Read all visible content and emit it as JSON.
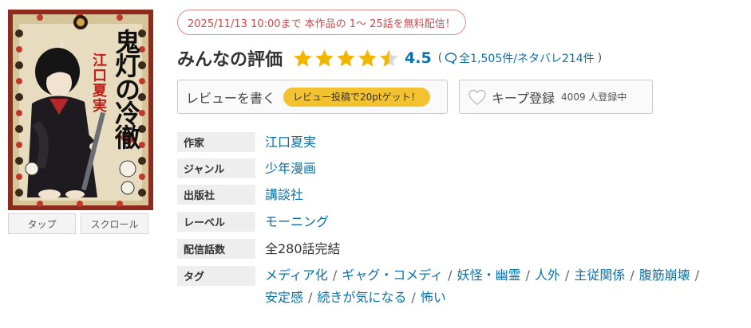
{
  "cover": {
    "title": "鬼灯の冷徹",
    "author": "江口夏実",
    "buttons": [
      "タップ",
      "スクロール"
    ]
  },
  "campaign": {
    "text": "2025/11/13 10:00まで 本作品の 1〜 25話を無料配信！"
  },
  "rating": {
    "title": "みんなの評価",
    "score": "4.5",
    "score_value": 4.5,
    "open_paren": "(",
    "review_count": "全1,505件/ネタバレ214件",
    "close_paren": ")",
    "colors": {
      "star": "#f2b600",
      "star_empty": "#d9d9d9",
      "accent": "#0a72a6"
    }
  },
  "actions": {
    "write_review": "レビューを書く",
    "points_badge": "レビュー投稿で20ptゲット！",
    "keep": "キープ登録",
    "keep_count": "4009 人登録中"
  },
  "info": {
    "author_label": "作家",
    "author": "江口夏実",
    "genre_label": "ジャンル",
    "genre": "少年漫画",
    "publisher_label": "出版社",
    "publisher": "講談社",
    "label_label": "レーベル",
    "label": "モーニング",
    "episodes_label": "配信話数",
    "episodes": "全280話完結",
    "tags_label": "タグ",
    "tags": [
      "メディア化",
      "ギャグ・コメディ",
      "妖怪・幽霊",
      "人外",
      "主従関係",
      "腹筋崩壊",
      "安定感",
      "続きが気になる",
      "怖い"
    ],
    "separator": "/"
  }
}
